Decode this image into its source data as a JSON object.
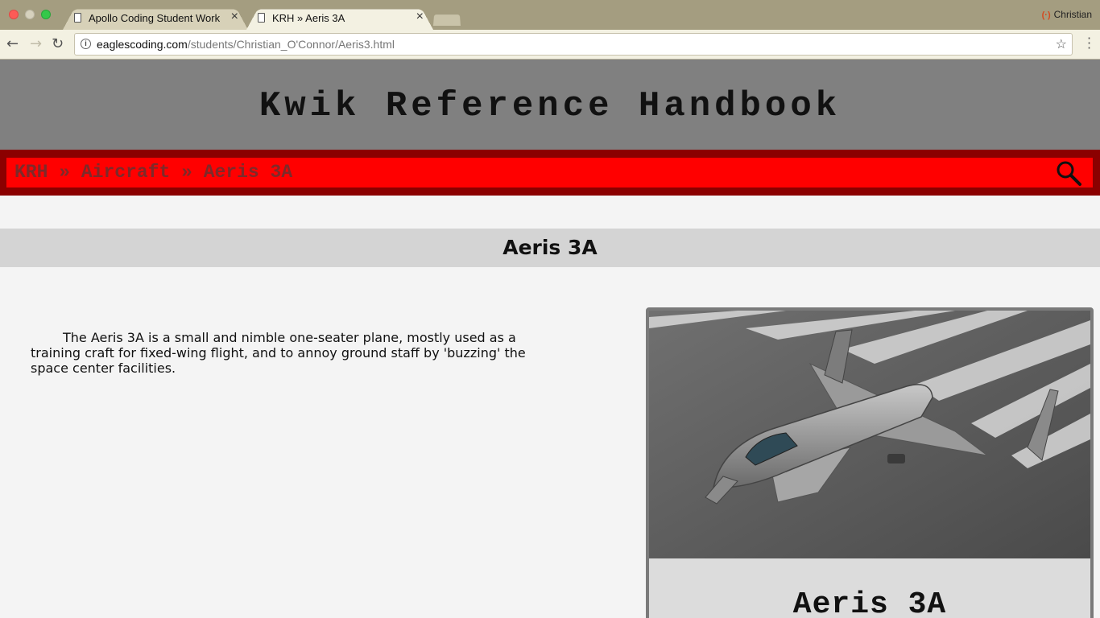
{
  "browser": {
    "tabs": [
      {
        "title": "Apollo Coding Student Work",
        "close": "×"
      },
      {
        "title": "KRH » Aeris 3A",
        "close": "×"
      }
    ],
    "profile_name": "Christian",
    "url_host": "eaglescoding.com",
    "url_path": "/students/Christian_O'Connor/Aeris3.html"
  },
  "site": {
    "title": "Kwik Reference Handbook",
    "breadcrumb": {
      "root": "KRH",
      "sep": "»",
      "section": "Aircraft",
      "current": "Aeris 3A"
    }
  },
  "article": {
    "heading": "Aeris 3A",
    "description": "The Aeris 3A is a small and nimble one-seater plane, mostly used as a training craft for fixed-wing flight, and to annoy ground staff by 'buzzing' the space center facilities."
  },
  "infobox": {
    "caption": "Aeris 3A"
  }
}
